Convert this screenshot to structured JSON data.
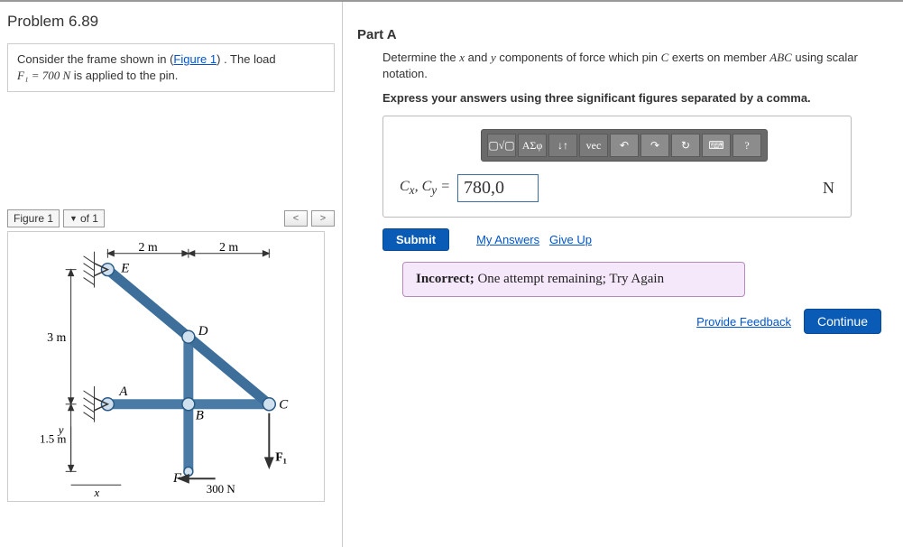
{
  "problem": {
    "title": "Problem 6.89",
    "prompt_pre": "Consider the frame shown in (",
    "prompt_link": "Figure 1",
    "prompt_post": ") . The load",
    "load_label": "F₁ = 700  N",
    "load_tail": " is applied to the pin."
  },
  "figure": {
    "select_label": "Figure 1",
    "of_text": "of 1",
    "nav_prev": "<",
    "nav_next": ">",
    "labels": {
      "top_dim_left": "2 m",
      "top_dim_right": "2 m",
      "left_dim_top": "3 m",
      "left_dim_bottom": "1.5 m",
      "E": "E",
      "D": "D",
      "A": "A",
      "B": "B",
      "C": "C",
      "F": "F",
      "F1": "F₁",
      "Fh": "300 N",
      "y": "y",
      "x": "x"
    }
  },
  "partA": {
    "title": "Part A",
    "desc_pre": "Determine the ",
    "desc_x": "x",
    "desc_mid": " and ",
    "desc_y": "y",
    "desc_mid2": " components of force which pin ",
    "desc_C": "C",
    "desc_mid3": " exerts on member ",
    "desc_ABC": "ABC",
    "desc_tail": " using scalar notation.",
    "instruct": "Express your answers using three significant figures separated by a comma.",
    "answer_label_html": "Cₓ, C_y  = ",
    "answer_value": "780,0",
    "unit": "N"
  },
  "toolbar": {
    "templates": "▢√▢",
    "greek": "ΑΣφ",
    "subscript": "↓↑",
    "vec": "vec",
    "undo": "↶",
    "redo": "↷",
    "reset": "↻",
    "keyboard": "⌨",
    "help": "?"
  },
  "actions": {
    "submit": "Submit",
    "my_answers": "My Answers",
    "give_up": "Give Up",
    "provide_feedback": "Provide Feedback",
    "continue": "Continue"
  },
  "feedback": {
    "pre": "Incorrect; ",
    "main": "One attempt remaining; Try Again"
  }
}
